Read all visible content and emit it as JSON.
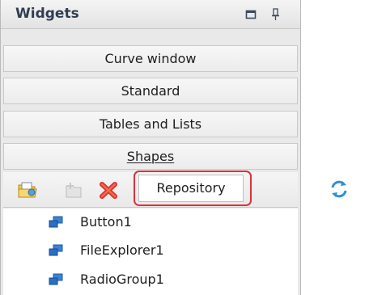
{
  "panel": {
    "title": "Widgets",
    "title_buttons": [
      "maximize-icon",
      "pin-icon"
    ]
  },
  "categories": [
    {
      "label": "Curve window"
    },
    {
      "label": "Standard"
    },
    {
      "label": "Tables and Lists"
    },
    {
      "label": "Shapes"
    }
  ],
  "toolbar": {
    "icons": [
      "open-folder-icon",
      "new-item-icon",
      "delete-icon",
      "refresh-icon"
    ],
    "active_tab": "Repository"
  },
  "repository_items": [
    {
      "label": "Button1",
      "icon": "component-icon"
    },
    {
      "label": "FileExplorer1",
      "icon": "component-icon"
    },
    {
      "label": "RadioGroup1",
      "icon": "component-icon"
    }
  ],
  "colors": {
    "highlight": "#e0303c",
    "title_text": "#2f3e52",
    "panel_bg": "#e9e9e9"
  }
}
